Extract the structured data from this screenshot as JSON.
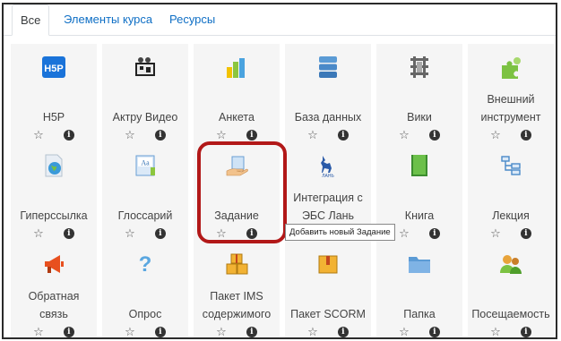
{
  "tabs": [
    {
      "label": "Все",
      "active": true
    },
    {
      "label": "Элементы курса",
      "active": false
    },
    {
      "label": "Ресурсы",
      "active": false
    }
  ],
  "activities": [
    {
      "label": "H5P",
      "icon": "h5p-icon"
    },
    {
      "label": "Актру Видео",
      "icon": "video-icon"
    },
    {
      "label": "Анкета",
      "icon": "bar-chart-icon"
    },
    {
      "label": "База данных",
      "icon": "database-icon"
    },
    {
      "label": "Вики",
      "icon": "wiki-icon"
    },
    {
      "label": "Внешний инструмент",
      "icon": "puzzle-icon"
    },
    {
      "label": "Гиперссылка",
      "icon": "globe-file-icon"
    },
    {
      "label": "Глоссарий",
      "icon": "glossary-icon"
    },
    {
      "label": "Задание",
      "icon": "assignment-hand-icon"
    },
    {
      "label": "Интеграция с ЭБС Лань",
      "icon": "lan-deer-icon"
    },
    {
      "label": "Книга",
      "icon": "book-icon"
    },
    {
      "label": "Лекция",
      "icon": "lesson-icon"
    },
    {
      "label": "Обратная связь",
      "icon": "megaphone-icon"
    },
    {
      "label": "Опрос",
      "icon": "question-icon"
    },
    {
      "label": "Пакет IMS содержимого",
      "icon": "boxes-icon"
    },
    {
      "label": "Пакет SCORM",
      "icon": "package-icon"
    },
    {
      "label": "Папка",
      "icon": "folder-icon"
    },
    {
      "label": "Посещаемость",
      "icon": "people-icon"
    }
  ],
  "tooltip": "Добавить новый Задание",
  "star_glyph": "☆",
  "info_glyph": "i"
}
